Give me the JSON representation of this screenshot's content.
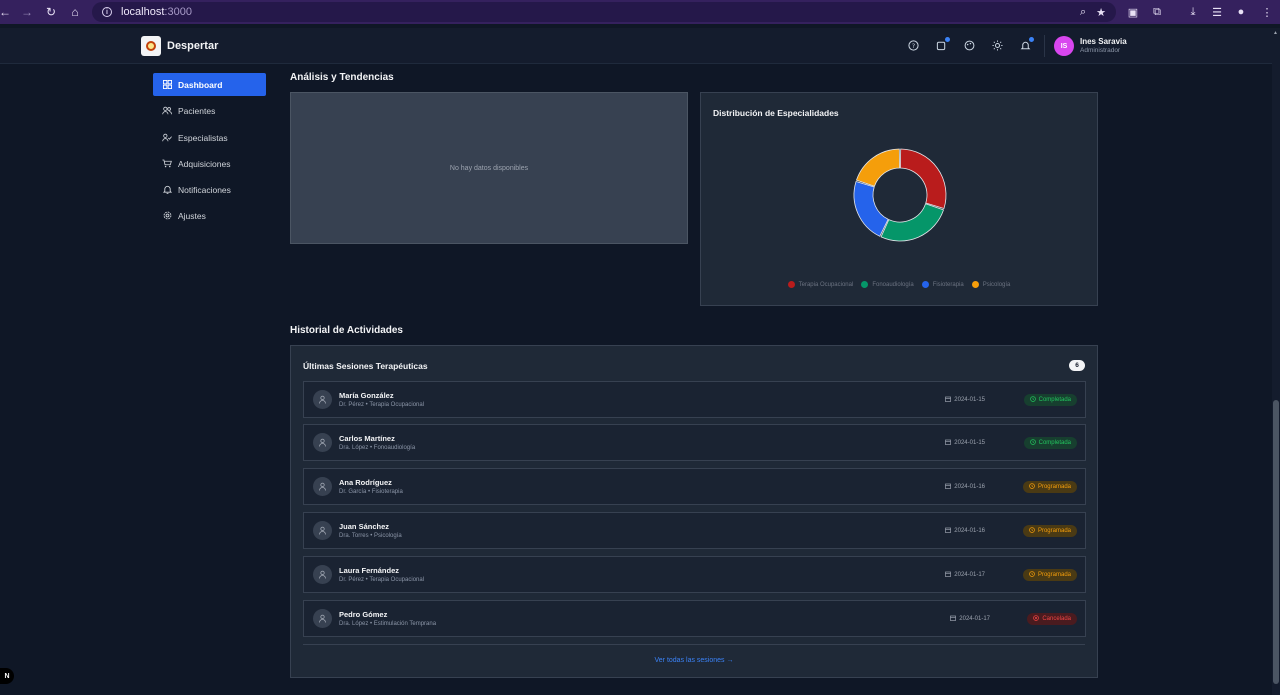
{
  "browser": {
    "url_host": "localhost",
    "url_port": ":3000"
  },
  "app": {
    "brand": "Despertar",
    "user": {
      "initials": "IS",
      "name": "Ines Saravia",
      "role": "Administrador"
    }
  },
  "sidebar": {
    "items": [
      {
        "label": "Dashboard",
        "icon": "dashboard-icon",
        "active": true
      },
      {
        "label": "Pacientes",
        "icon": "users-icon",
        "active": false
      },
      {
        "label": "Especialistas",
        "icon": "user-check-icon",
        "active": false
      },
      {
        "label": "Adquisiciones",
        "icon": "cart-icon",
        "active": false
      },
      {
        "label": "Notificaciones",
        "icon": "bell-icon",
        "active": false
      },
      {
        "label": "Ajustes",
        "icon": "gear-icon",
        "active": false
      }
    ]
  },
  "analysis": {
    "section_title": "Análisis y Tendencias",
    "empty_message": "No hay datos disponibles",
    "chart_title": "Distribución de Especialidades"
  },
  "chart_data": {
    "type": "pie",
    "title": "Distribución de Especialidades",
    "categories": [
      "Terapia Ocupacional",
      "Fonoaudiología",
      "Fisioterapia",
      "Psicología"
    ],
    "values": [
      30,
      27,
      23,
      20
    ],
    "colors": [
      "#b91c1c",
      "#059669",
      "#2563eb",
      "#f59e0b"
    ],
    "donut": true,
    "legend": "bottom"
  },
  "history": {
    "section_title": "Historial de Actividades",
    "panel_title": "Últimas Sesiones Terapéuticas",
    "count": "6",
    "sessions": [
      {
        "name": "María González",
        "sub": "Dr. Pérez • Terapia Ocupacional",
        "date": "2024-01-15",
        "status": "Completada",
        "kind": "completada"
      },
      {
        "name": "Carlos Martínez",
        "sub": "Dra. López • Fonoaudiología",
        "date": "2024-01-15",
        "status": "Completada",
        "kind": "completada"
      },
      {
        "name": "Ana Rodríguez",
        "sub": "Dr. García • Fisioterapia",
        "date": "2024-01-16",
        "status": "Programada",
        "kind": "programada"
      },
      {
        "name": "Juan Sánchez",
        "sub": "Dra. Torres • Psicología",
        "date": "2024-01-16",
        "status": "Programada",
        "kind": "programada"
      },
      {
        "name": "Laura Fernández",
        "sub": "Dr. Pérez • Terapia Ocupacional",
        "date": "2024-01-17",
        "status": "Programada",
        "kind": "programada"
      },
      {
        "name": "Pedro Gómez",
        "sub": "Dra. López • Estimulación Temprana",
        "date": "2024-01-17",
        "status": "Cancelada",
        "kind": "cancelada"
      }
    ],
    "view_all": "Ver todas las sesiones →"
  },
  "dev_badge": "N"
}
